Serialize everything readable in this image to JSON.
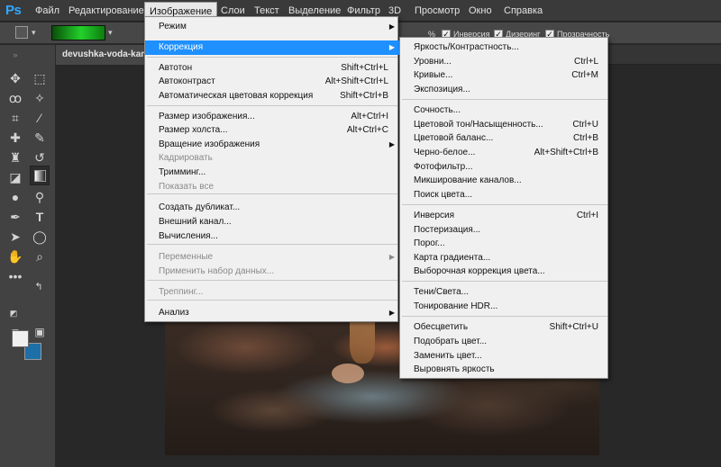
{
  "app": {
    "logo": "Ps"
  },
  "menubar": {
    "items": [
      "Файл",
      "Редактирование",
      "Изображение",
      "Слои",
      "Текст",
      "Выделение",
      "Фильтр",
      "3D",
      "Просмотр",
      "Окно",
      "Справка"
    ],
    "active": "Изображение"
  },
  "options": {
    "percent": "%",
    "inversion": "Инверсия",
    "dither": "Дизеринг",
    "transparency": "Прозрачность",
    "gradient_colors": [
      "#0a4d0a",
      "#23d12a",
      "#0e7c10"
    ]
  },
  "document": {
    "tab_title": "devushka-voda-kamni"
  },
  "toolbar": {
    "icons": [
      "move-icon",
      "marquee-icon",
      "lasso-icon",
      "magic-wand-icon",
      "crop-icon",
      "eyedropper-icon",
      "spot-healing-icon",
      "brush-icon",
      "clone-stamp-icon",
      "history-brush-icon",
      "eraser-icon",
      "gradient-icon",
      "blur-icon",
      "dodge-icon",
      "pen-icon",
      "type-icon",
      "path-select-icon",
      "ellipse-icon",
      "hand-icon",
      "zoom-icon",
      "more-tools-icon"
    ],
    "fg_color": "#f0f0f0",
    "bg_color": "#1d6fa8"
  },
  "image_menu": [
    {
      "label": "Режим",
      "shortcut": "",
      "submenu": true,
      "disabled": false
    },
    {
      "label": "Коррекция",
      "shortcut": "",
      "submenu": true,
      "disabled": false,
      "highlighted": true
    },
    {
      "label": "Автотон",
      "shortcut": "Shift+Ctrl+L",
      "disabled": false
    },
    {
      "label": "Автоконтраст",
      "shortcut": "Alt+Shift+Ctrl+L",
      "disabled": false
    },
    {
      "label": "Автоматическая цветовая коррекция",
      "shortcut": "Shift+Ctrl+B",
      "disabled": false
    },
    {
      "label": "Размер изображения...",
      "shortcut": "Alt+Ctrl+I",
      "disabled": false
    },
    {
      "label": "Размер холста...",
      "shortcut": "Alt+Ctrl+C",
      "disabled": false
    },
    {
      "label": "Вращение изображения",
      "shortcut": "",
      "submenu": true,
      "disabled": false
    },
    {
      "label": "Кадрировать",
      "shortcut": "",
      "disabled": true
    },
    {
      "label": "Тримминг...",
      "shortcut": "",
      "disabled": false
    },
    {
      "label": "Показать все",
      "shortcut": "",
      "disabled": true
    },
    {
      "label": "Создать дубликат...",
      "shortcut": "",
      "disabled": false
    },
    {
      "label": "Внешний канал...",
      "shortcut": "",
      "disabled": false
    },
    {
      "label": "Вычисления...",
      "shortcut": "",
      "disabled": false
    },
    {
      "label": "Переменные",
      "shortcut": "",
      "submenu": true,
      "disabled": true
    },
    {
      "label": "Применить набор данных...",
      "shortcut": "",
      "disabled": true
    },
    {
      "label": "Треппинг...",
      "shortcut": "",
      "disabled": true
    },
    {
      "label": "Анализ",
      "shortcut": "",
      "submenu": true,
      "disabled": false
    }
  ],
  "correction_menu": [
    {
      "label": "Яркость/Контрастность...",
      "shortcut": ""
    },
    {
      "label": "Уровни...",
      "shortcut": "Ctrl+L"
    },
    {
      "label": "Кривые...",
      "shortcut": "Ctrl+M"
    },
    {
      "label": "Экспозиция...",
      "shortcut": ""
    },
    {
      "label": "Сочность...",
      "shortcut": ""
    },
    {
      "label": "Цветовой тон/Насыщенность...",
      "shortcut": "Ctrl+U"
    },
    {
      "label": "Цветовой баланс...",
      "shortcut": "Ctrl+B"
    },
    {
      "label": "Черно-белое...",
      "shortcut": "Alt+Shift+Ctrl+B"
    },
    {
      "label": "Фотофильтр...",
      "shortcut": ""
    },
    {
      "label": "Микширование каналов...",
      "shortcut": ""
    },
    {
      "label": "Поиск цвета...",
      "shortcut": ""
    },
    {
      "label": "Инверсия",
      "shortcut": "Ctrl+I"
    },
    {
      "label": "Постеризация...",
      "shortcut": ""
    },
    {
      "label": "Порог...",
      "shortcut": ""
    },
    {
      "label": "Карта градиента...",
      "shortcut": ""
    },
    {
      "label": "Выборочная коррекция цвета...",
      "shortcut": ""
    },
    {
      "label": "Тени/Света...",
      "shortcut": ""
    },
    {
      "label": "Тонирование HDR...",
      "shortcut": ""
    },
    {
      "label": "Обесцветить",
      "shortcut": "Shift+Ctrl+U"
    },
    {
      "label": "Подобрать цвет...",
      "shortcut": ""
    },
    {
      "label": "Заменить цвет...",
      "shortcut": ""
    },
    {
      "label": "Выровнять яркость",
      "shortcut": ""
    }
  ]
}
